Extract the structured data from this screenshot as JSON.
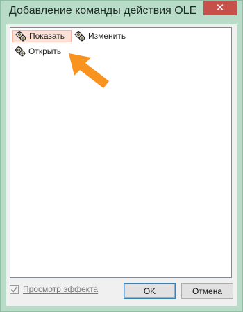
{
  "window": {
    "title": "Добавление команды действия OLE",
    "close_glyph": "✕"
  },
  "list": {
    "items": [
      {
        "label": "Показать",
        "icon": "gears-icon",
        "selected": true
      },
      {
        "label": "Изменить",
        "icon": "gears-icon",
        "selected": false
      },
      {
        "label": "Открыть",
        "icon": "gears-icon",
        "selected": false
      }
    ]
  },
  "footer": {
    "preview_label": "Просмотр эффекта",
    "preview_checked": true,
    "ok_label": "OK",
    "cancel_label": "Отмена"
  },
  "annotation": {
    "arrow_color": "#f7931e"
  }
}
